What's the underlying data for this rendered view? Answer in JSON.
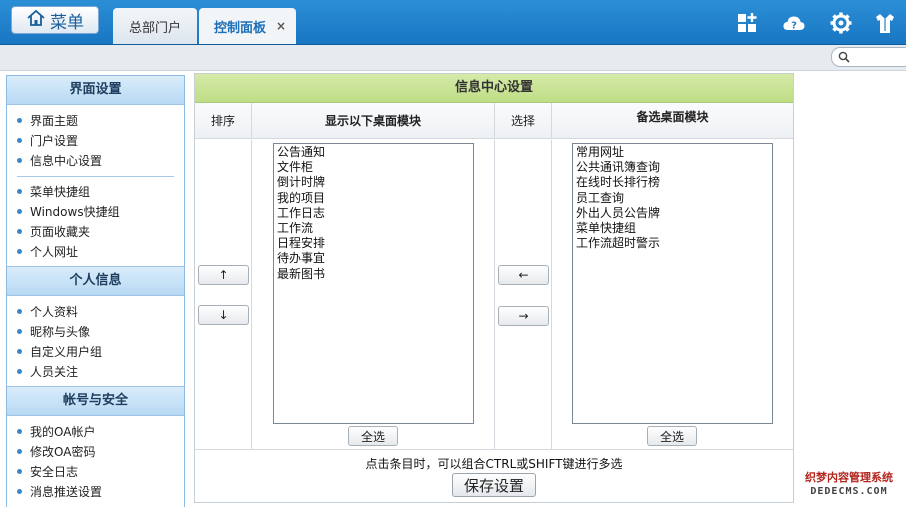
{
  "header": {
    "menu_label": "菜单",
    "tabs": [
      {
        "label": "总部门户"
      },
      {
        "label": "控制面板",
        "close": "×"
      }
    ],
    "icons": [
      "add-module-icon",
      "help-cloud-icon",
      "settings-gear-icon",
      "user-shirt-icon"
    ]
  },
  "sidebar": {
    "sections": [
      {
        "title": "界面设置",
        "groups": [
          [
            "界面主题",
            "门户设置",
            "信息中心设置"
          ],
          [
            "菜单快捷组",
            "Windows快捷组",
            "页面收藏夹",
            "个人网址"
          ]
        ]
      },
      {
        "title": "个人信息",
        "groups": [
          [
            "个人资料",
            "昵称与头像",
            "自定义用户组",
            "人员关注"
          ]
        ]
      },
      {
        "title": "帐号与安全",
        "groups": [
          [
            "我的OA帐户",
            "修改OA密码",
            "安全日志",
            "消息推送设置"
          ]
        ]
      }
    ]
  },
  "panel": {
    "title": "信息中心设置",
    "headers": {
      "sort": "排序",
      "show": "显示以下桌面模块",
      "choose": "选择",
      "available": "备选桌面模块"
    },
    "shown_modules": [
      "公告通知",
      "文件柜",
      "倒计时牌",
      "我的项目",
      "工作日志",
      "工作流",
      "日程安排",
      "待办事宜",
      "最新图书"
    ],
    "available_modules": [
      "常用网址",
      "公共通讯簿查询",
      "在线时长排行榜",
      "员工查询",
      "外出人员公告牌",
      "菜单快捷组",
      "工作流超时警示"
    ],
    "sort_up": "↑",
    "sort_down": "↓",
    "move_left": "←",
    "move_right": "→",
    "select_all": "全选",
    "hint": "点击条目时，可以组合CTRL或SHIFT键进行多选",
    "save": "保存设置"
  },
  "watermark": {
    "line1": "织梦内容管理系统",
    "line2": "DEDECMS.COM"
  },
  "colors": {
    "topbar": "#1f80c9",
    "sidebar_header": "#c6e2f7",
    "panel_title": "#c9e394"
  }
}
